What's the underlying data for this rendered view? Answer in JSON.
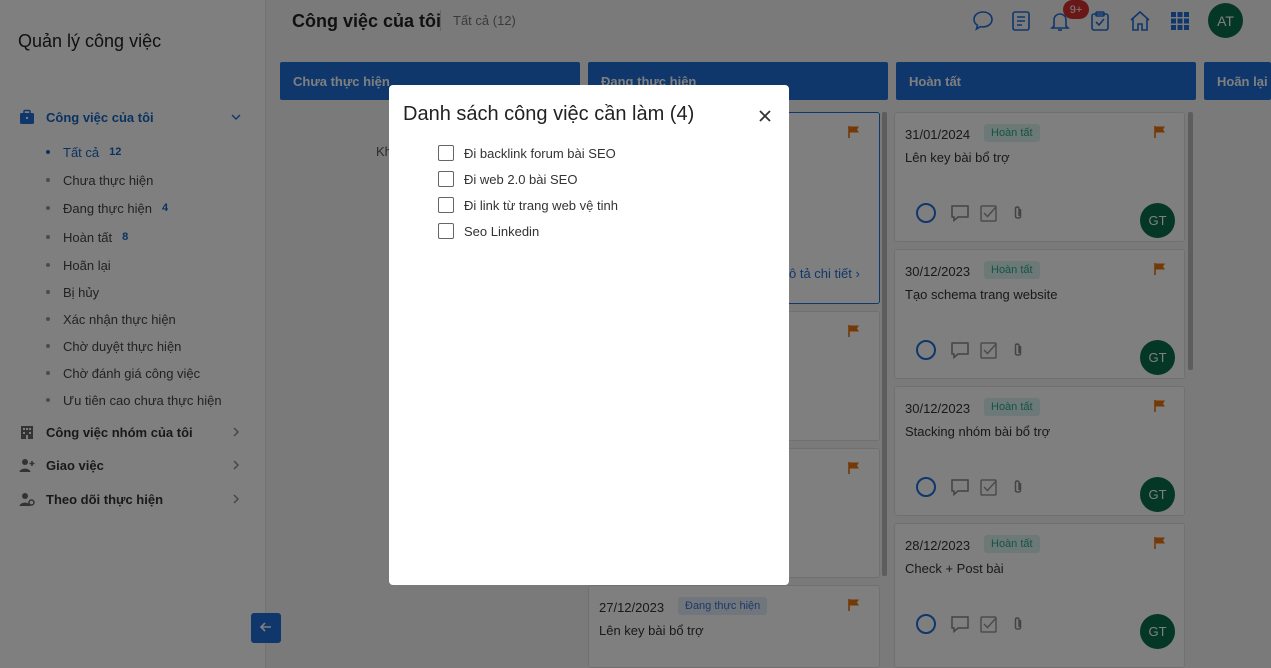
{
  "sidebar": {
    "app_title": "Quản lý công việc",
    "my_tasks": {
      "label": "Công việc của tôi",
      "items": [
        {
          "label": "Tất cả",
          "count": "12"
        },
        {
          "label": "Chưa thực hiện"
        },
        {
          "label": "Đang thực hiện",
          "count": "4"
        },
        {
          "label": "Hoàn tất",
          "count": "8"
        },
        {
          "label": "Hoãn lại"
        },
        {
          "label": "Bị hủy"
        },
        {
          "label": "Xác nhận thực hiện"
        },
        {
          "label": "Chờ duyệt thực hiện"
        },
        {
          "label": "Chờ đánh giá công việc"
        },
        {
          "label": "Ưu tiên cao chưa thực hiện"
        }
      ]
    },
    "group_tasks": {
      "label": "Công việc nhóm của tôi"
    },
    "assign": {
      "label": "Giao việc"
    },
    "follow": {
      "label": "Theo dõi thực hiện"
    }
  },
  "header": {
    "title": "Công việc của tôi",
    "filter": "Tất cả (12)",
    "notification_badge": "9+",
    "avatar_initials": "AT"
  },
  "board": {
    "columns": [
      {
        "label": "Chưa thực hiện"
      },
      {
        "label": "Đang thực hiện"
      },
      {
        "label": "Hoàn tất"
      },
      {
        "label": "Hoãn lại"
      }
    ],
    "todo_partial_text": "Kh",
    "detail_link": "ô tả chi tiết",
    "doing_bottom_card": {
      "date": "27/12/2023",
      "status": "Đang thực hiện",
      "title": "Lên key bài bổ trợ"
    },
    "done_cards": [
      {
        "date": "31/01/2024",
        "status": "Hoàn tất",
        "title": "Lên key bài bổ trợ",
        "assignee": "GT"
      },
      {
        "date": "30/12/2023",
        "status": "Hoàn tất",
        "title": "Tạo schema trang website",
        "assignee": "GT"
      },
      {
        "date": "30/12/2023",
        "status": "Hoàn tất",
        "title": "Stacking nhóm bài bổ trợ",
        "assignee": "GT"
      },
      {
        "date": "28/12/2023",
        "status": "Hoàn tất",
        "title": "Check + Post bài",
        "assignee": "GT"
      }
    ]
  },
  "modal": {
    "title": "Danh sách công việc cần làm (4)",
    "items": [
      {
        "label": "Đi backlink forum bài SEO"
      },
      {
        "label": "Đi web 2.0 bài SEO"
      },
      {
        "label": "Đi link từ trang web vệ tinh"
      },
      {
        "label": "Seo Linkedin"
      }
    ]
  },
  "colors": {
    "primary": "#1e6fd9",
    "flag": "#e8720c",
    "avatar": "#0b6e4f",
    "badge": "#d32f2f"
  }
}
